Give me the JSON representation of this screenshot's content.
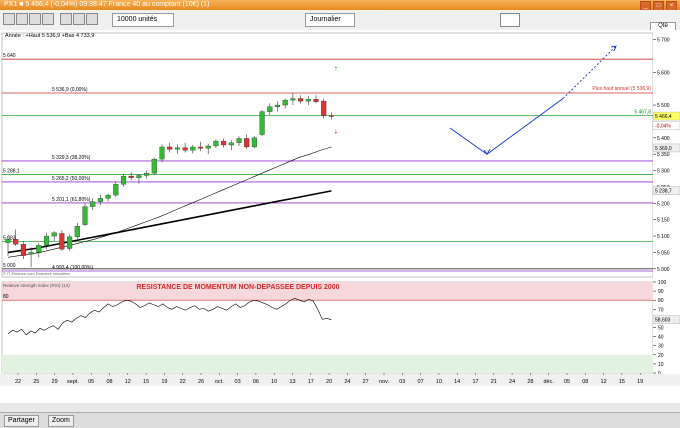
{
  "window": {
    "title": "PX1 ■ 5 466,4 (-0,04%) 09:38:47 France 40 au comptant (10€) (1)"
  },
  "toolbar": {
    "quantity_value": "10000 unités",
    "timeframe_value": "Journalier",
    "qte_label": "Qté"
  },
  "legend_text": "Année : +Haut 5 536,9 +Bas 4 733,9",
  "source_text": "© IT-Finance.com Données retardées",
  "indicator_label": "Relative strength index (RSI) (14)",
  "annotation": "RESISTANCE DE MOMENTUM NON-DEPASSEE DEPUIS 2000",
  "bottom": {
    "partager": "Partager",
    "zoom": "Zoom"
  },
  "levels": [
    {
      "label": "5 640",
      "value": 5640,
      "color": "#cc3333"
    },
    {
      "label": "5 536,9 (0,00%)",
      "value": 5536.9,
      "color": "#cc3333"
    },
    {
      "label": "5 467,8",
      "value": 5467.8,
      "color": "#33aa33"
    },
    {
      "label": "5 329,3 (38,20%)",
      "value": 5329.3,
      "color": "#9933cc"
    },
    {
      "label": "5 288,1",
      "value": 5288.1,
      "color": "#33aa33"
    },
    {
      "label": "5 265,2 (50,00%)",
      "value": 5265.2,
      "color": "#9933cc"
    },
    {
      "label": "5 201,1 (61,80%)",
      "value": 5201.1,
      "color": "#9933cc"
    },
    {
      "label": "5 083",
      "value": 5083,
      "color": "#33aa33"
    },
    {
      "label": "5 000",
      "value": 5000,
      "color": "#333333"
    },
    {
      "label": "4 993,4 (100,00%)",
      "value": 4993.4,
      "color": "#9933cc"
    }
  ],
  "plus_haut_annuel": "Plus haut annuel (5 536,9)",
  "price_badges": [
    {
      "label": "5 466,4",
      "value": 5466.4,
      "bg": "#ffff66",
      "color": "#000000"
    },
    {
      "label": "-0,04%",
      "value": 5437,
      "bg": "#ffffff",
      "color": "#cc0000"
    },
    {
      "label": "5 369,0",
      "value": 5369.0,
      "bg": "#eeeeee",
      "color": "#000000"
    },
    {
      "label": "5 238,7",
      "value": 5238.7,
      "bg": "#eeeeee",
      "color": "#000000"
    }
  ],
  "rsi_badge": "58,603",
  "rsi_ref_label": "80",
  "chart_data": {
    "type": "candlestick",
    "y_axis_ticks": [
      5700,
      5600,
      5500,
      5400,
      5350,
      5300,
      5250,
      5200,
      5150,
      5100,
      5050,
      5000
    ],
    "y_axis_tick_labels": [
      "5 700",
      "5 600",
      "5 500",
      "5 400",
      "5 350",
      "5 300",
      "5 250",
      "5 200",
      "5 150",
      "5 100",
      "5 050",
      "5 000"
    ],
    "ylim": [
      4975,
      5720
    ],
    "rsi_ticks": [
      100,
      90,
      80,
      70,
      60,
      50,
      40,
      30,
      20,
      10,
      0
    ],
    "rsi_ylim": [
      0,
      100
    ],
    "x_tick_labels": [
      "22",
      "25",
      "29",
      "sept.",
      "05",
      "08",
      "12",
      "15",
      "19",
      "22",
      "26",
      "oct.",
      "03",
      "06",
      "10",
      "13",
      "17",
      "20",
      "24",
      "27",
      "nov.",
      "03",
      "07",
      "10",
      "14",
      "17",
      "21",
      "24",
      "28",
      "déc.",
      "05",
      "08",
      "12",
      "15",
      "19"
    ],
    "candles": [
      {
        "o": 5080,
        "h": 5100,
        "l": 5040,
        "c": 5090
      },
      {
        "o": 5090,
        "h": 5120,
        "l": 5070,
        "c": 5075
      },
      {
        "o": 5075,
        "h": 5085,
        "l": 5030,
        "c": 5040
      },
      {
        "o": 5045,
        "h": 5065,
        "l": 5005,
        "c": 5050
      },
      {
        "o": 5050,
        "h": 5080,
        "l": 5035,
        "c": 5072
      },
      {
        "o": 5072,
        "h": 5110,
        "l": 5060,
        "c": 5100
      },
      {
        "o": 5100,
        "h": 5115,
        "l": 5085,
        "c": 5110
      },
      {
        "o": 5108,
        "h": 5118,
        "l": 5055,
        "c": 5060
      },
      {
        "o": 5062,
        "h": 5105,
        "l": 5055,
        "c": 5098
      },
      {
        "o": 5098,
        "h": 5140,
        "l": 5090,
        "c": 5130
      },
      {
        "o": 5135,
        "h": 5200,
        "l": 5130,
        "c": 5190
      },
      {
        "o": 5190,
        "h": 5215,
        "l": 5180,
        "c": 5205
      },
      {
        "o": 5205,
        "h": 5225,
        "l": 5195,
        "c": 5215
      },
      {
        "o": 5215,
        "h": 5230,
        "l": 5205,
        "c": 5225
      },
      {
        "o": 5225,
        "h": 5265,
        "l": 5220,
        "c": 5258
      },
      {
        "o": 5258,
        "h": 5290,
        "l": 5250,
        "c": 5283
      },
      {
        "o": 5283,
        "h": 5295,
        "l": 5270,
        "c": 5278
      },
      {
        "o": 5278,
        "h": 5290,
        "l": 5260,
        "c": 5285
      },
      {
        "o": 5285,
        "h": 5300,
        "l": 5275,
        "c": 5292
      },
      {
        "o": 5292,
        "h": 5340,
        "l": 5288,
        "c": 5335
      },
      {
        "o": 5335,
        "h": 5380,
        "l": 5325,
        "c": 5372
      },
      {
        "o": 5372,
        "h": 5385,
        "l": 5355,
        "c": 5365
      },
      {
        "o": 5365,
        "h": 5380,
        "l": 5350,
        "c": 5370
      },
      {
        "o": 5370,
        "h": 5385,
        "l": 5355,
        "c": 5362
      },
      {
        "o": 5362,
        "h": 5378,
        "l": 5352,
        "c": 5372
      },
      {
        "o": 5372,
        "h": 5388,
        "l": 5360,
        "c": 5368
      },
      {
        "o": 5368,
        "h": 5382,
        "l": 5350,
        "c": 5375
      },
      {
        "o": 5375,
        "h": 5395,
        "l": 5368,
        "c": 5390
      },
      {
        "o": 5390,
        "h": 5398,
        "l": 5370,
        "c": 5378
      },
      {
        "o": 5378,
        "h": 5392,
        "l": 5362,
        "c": 5385
      },
      {
        "o": 5385,
        "h": 5405,
        "l": 5375,
        "c": 5398
      },
      {
        "o": 5398,
        "h": 5410,
        "l": 5365,
        "c": 5372
      },
      {
        "o": 5372,
        "h": 5405,
        "l": 5368,
        "c": 5400
      },
      {
        "o": 5410,
        "h": 5485,
        "l": 5405,
        "c": 5480
      },
      {
        "o": 5480,
        "h": 5505,
        "l": 5470,
        "c": 5495
      },
      {
        "o": 5495,
        "h": 5512,
        "l": 5480,
        "c": 5500
      },
      {
        "o": 5500,
        "h": 5520,
        "l": 5490,
        "c": 5515
      },
      {
        "o": 5515,
        "h": 5537,
        "l": 5500,
        "c": 5520
      },
      {
        "o": 5520,
        "h": 5530,
        "l": 5505,
        "c": 5512
      },
      {
        "o": 5512,
        "h": 5528,
        "l": 5500,
        "c": 5518
      },
      {
        "o": 5518,
        "h": 5530,
        "l": 5505,
        "c": 5510
      },
      {
        "o": 5512,
        "h": 5520,
        "l": 5460,
        "c": 5468
      },
      {
        "o": 5468,
        "h": 5478,
        "l": 5455,
        "c": 5466
      }
    ],
    "ma_short": [
      5035,
      5040,
      5045,
      5050,
      5058,
      5066,
      5074,
      5082,
      5090,
      5100,
      5110,
      5122,
      5134,
      5146,
      5158,
      5172,
      5186,
      5200,
      5214,
      5228,
      5242,
      5256,
      5270,
      5284,
      5298,
      5312,
      5326,
      5340,
      5350,
      5362,
      5372
    ],
    "ma_long": [
      5050,
      5056,
      5062,
      5070,
      5078,
      5086,
      5094,
      5102,
      5110,
      5118,
      5126,
      5134,
      5142,
      5150,
      5158,
      5166,
      5174,
      5182,
      5190,
      5198,
      5206,
      5214,
      5222,
      5230,
      5238
    ],
    "rsi": [
      43,
      47,
      45,
      48,
      42,
      46,
      44,
      49,
      47,
      50,
      52,
      48,
      55,
      58,
      56,
      60,
      63,
      61,
      66,
      69,
      67,
      72,
      76,
      73,
      75,
      78,
      80,
      79,
      76,
      72,
      74,
      77,
      75,
      73,
      76,
      72,
      70,
      73,
      71,
      69,
      72,
      74,
      70,
      71,
      68,
      70,
      73,
      71,
      69,
      73,
      76,
      72,
      74,
      78,
      80,
      79,
      77,
      75,
      72,
      70,
      73,
      76,
      80,
      82,
      80,
      78,
      81,
      79,
      70,
      59,
      60,
      58.6
    ],
    "projection_blue_solid": [
      [
        5430,
        0
      ],
      [
        5350,
        1
      ],
      [
        5520,
        2
      ]
    ],
    "projection_blue_dotted": [
      [
        5520,
        0
      ],
      [
        5680,
        1
      ]
    ]
  }
}
